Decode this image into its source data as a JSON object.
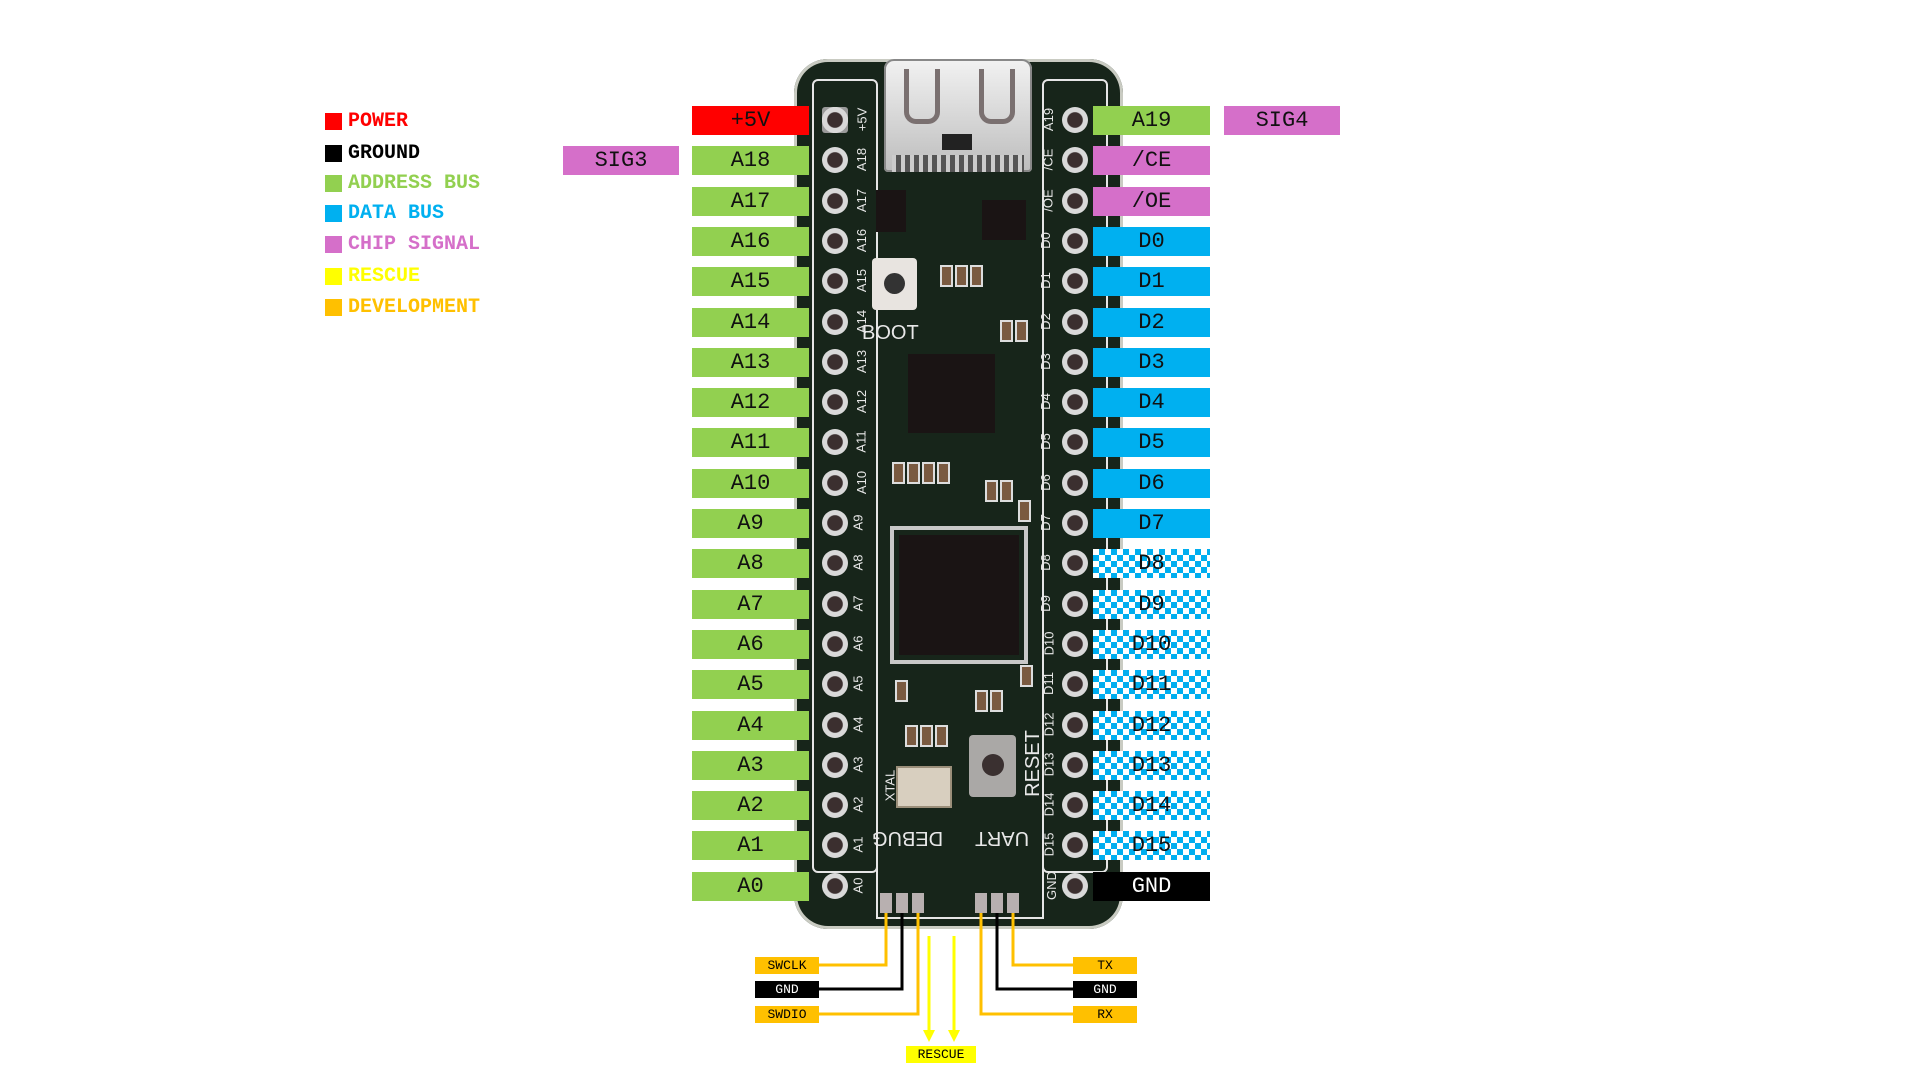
{
  "legend": [
    {
      "label": "POWER",
      "color": "#ff0000"
    },
    {
      "label": "GROUND",
      "color": "#000000"
    },
    {
      "label": "ADDRESS BUS",
      "color": "#92d050"
    },
    {
      "label": "DATA BUS",
      "color": "#00b0f0"
    },
    {
      "label": "CHIP SIGNAL",
      "color": "#d56fc9"
    },
    {
      "label": "RESCUE",
      "color": "#ffff00"
    },
    {
      "label": "DEVELOPMENT",
      "color": "#ffc000"
    }
  ],
  "left_pins": [
    {
      "label": "+5V",
      "type": "power",
      "silk": "+5V"
    },
    {
      "label": "A18",
      "type": "address",
      "silk": "A18"
    },
    {
      "label": "A17",
      "type": "address",
      "silk": "A17"
    },
    {
      "label": "A16",
      "type": "address",
      "silk": "A16"
    },
    {
      "label": "A15",
      "type": "address",
      "silk": "A15"
    },
    {
      "label": "A14",
      "type": "address",
      "silk": "A14"
    },
    {
      "label": "A13",
      "type": "address",
      "silk": "A13"
    },
    {
      "label": "A12",
      "type": "address",
      "silk": "A12"
    },
    {
      "label": "A11",
      "type": "address",
      "silk": "A11"
    },
    {
      "label": "A10",
      "type": "address",
      "silk": "A10"
    },
    {
      "label": "A9",
      "type": "address",
      "silk": "A9"
    },
    {
      "label": "A8",
      "type": "address",
      "silk": "A8"
    },
    {
      "label": "A7",
      "type": "address",
      "silk": "A7"
    },
    {
      "label": "A6",
      "type": "address",
      "silk": "A6"
    },
    {
      "label": "A5",
      "type": "address",
      "silk": "A5"
    },
    {
      "label": "A4",
      "type": "address",
      "silk": "A4"
    },
    {
      "label": "A3",
      "type": "address",
      "silk": "A3"
    },
    {
      "label": "A2",
      "type": "address",
      "silk": "A2"
    },
    {
      "label": "A1",
      "type": "address",
      "silk": "A1"
    },
    {
      "label": "A0",
      "type": "address",
      "silk": "A0"
    }
  ],
  "right_pins": [
    {
      "label": "A19",
      "type": "address",
      "silk": "A19"
    },
    {
      "label": "/CE",
      "type": "chip",
      "silk": "/CE"
    },
    {
      "label": "/OE",
      "type": "chip",
      "silk": "/OE"
    },
    {
      "label": "D0",
      "type": "data",
      "silk": "D0"
    },
    {
      "label": "D1",
      "type": "data",
      "silk": "D1"
    },
    {
      "label": "D2",
      "type": "data",
      "silk": "D2"
    },
    {
      "label": "D3",
      "type": "data",
      "silk": "D3"
    },
    {
      "label": "D4",
      "type": "data",
      "silk": "D4"
    },
    {
      "label": "D5",
      "type": "data",
      "silk": "D5"
    },
    {
      "label": "D6",
      "type": "data",
      "silk": "D6"
    },
    {
      "label": "D7",
      "type": "data",
      "silk": "D7"
    },
    {
      "label": "D8",
      "type": "data-checker",
      "silk": "D8"
    },
    {
      "label": "D9",
      "type": "data-checker",
      "silk": "D9"
    },
    {
      "label": "D10",
      "type": "data-checker",
      "silk": "D10"
    },
    {
      "label": "D11",
      "type": "data-checker",
      "silk": "D11"
    },
    {
      "label": "D12",
      "type": "data-checker",
      "silk": "D12"
    },
    {
      "label": "D13",
      "type": "data-checker",
      "silk": "D13"
    },
    {
      "label": "D14",
      "type": "data-checker",
      "silk": "D14"
    },
    {
      "label": "D15",
      "type": "data-checker",
      "silk": "D15"
    },
    {
      "label": "GND",
      "type": "ground",
      "silk": "GND"
    }
  ],
  "extra": {
    "sig3": "SIG3",
    "sig4": "SIG4"
  },
  "board_text": {
    "boot": "BOOT",
    "reset": "RESET",
    "debug": "DEBUG",
    "uart": "UART",
    "xtal": "XTAL"
  },
  "debug_header": {
    "swclk": "SWCLK",
    "gnd": "GND",
    "swdio": "SWDIO"
  },
  "uart_header": {
    "tx": "TX",
    "gnd": "GND",
    "rx": "RX"
  },
  "rescue": "RESCUE",
  "colors": {
    "power": "#ff0000",
    "ground": "#000000",
    "address": "#92d050",
    "data": "#00b0f0",
    "chip": "#d56fc9",
    "rescue": "#ffff00",
    "development": "#ffc000",
    "board": "#17251a"
  }
}
